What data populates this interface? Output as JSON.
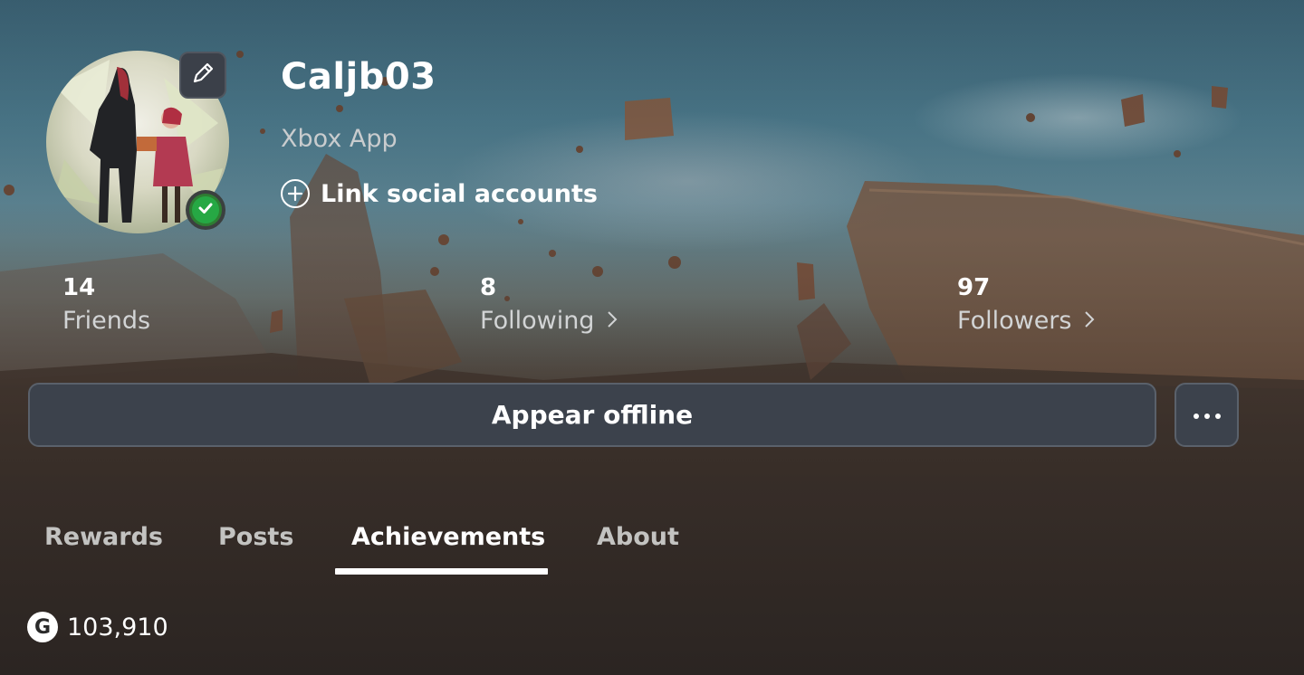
{
  "profile": {
    "gamertag": "Caljb03",
    "platform": "Xbox App",
    "link_social_label": "Link social accounts"
  },
  "stats": {
    "friends": {
      "count": "14",
      "label": "Friends"
    },
    "following": {
      "count": "8",
      "label": "Following"
    },
    "followers": {
      "count": "97",
      "label": "Followers"
    }
  },
  "actions": {
    "appear_offline_label": "Appear offline"
  },
  "tabs": [
    {
      "label": "Rewards",
      "active": false
    },
    {
      "label": "Posts",
      "active": false
    },
    {
      "label": "Achievements",
      "active": true
    },
    {
      "label": "About",
      "active": false
    }
  ],
  "gamerscore": {
    "badge": "G",
    "value": "103,910"
  },
  "icons": {
    "edit": "pencil-icon",
    "presence": "checkmark-icon",
    "link": "plus-circle-icon",
    "chevron": "chevron-right-icon",
    "more": "ellipsis-icon"
  },
  "colors": {
    "button_bg": "#3c424c",
    "presence_green": "#26a844",
    "tab_active": "#ffffff",
    "tab_inactive": "#c3c3c1"
  }
}
